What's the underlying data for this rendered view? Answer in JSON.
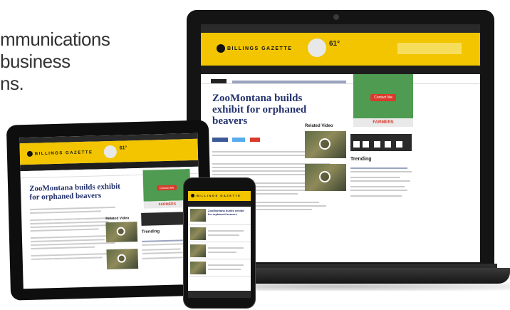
{
  "headline": {
    "line1": "mmunications",
    "line2": "business",
    "line3": "ns."
  },
  "site": {
    "logo_text": "BILLINGS GAZETTE",
    "temperature": "61°",
    "article_title": "ZooMontana builds exhibit for orphaned beavers",
    "related_video_label": "Related Video",
    "trending_label": "Trending",
    "ad_button": "Contact Me",
    "ad_brand": "FARMERS",
    "phone_headline": "ZooMontana builds exhibit for orphaned beavers"
  },
  "colors": {
    "brand_yellow": "#f2c500",
    "headline_blue": "#24326d",
    "ad_green": "#4f9b52",
    "accent_red": "#d93a2b"
  }
}
